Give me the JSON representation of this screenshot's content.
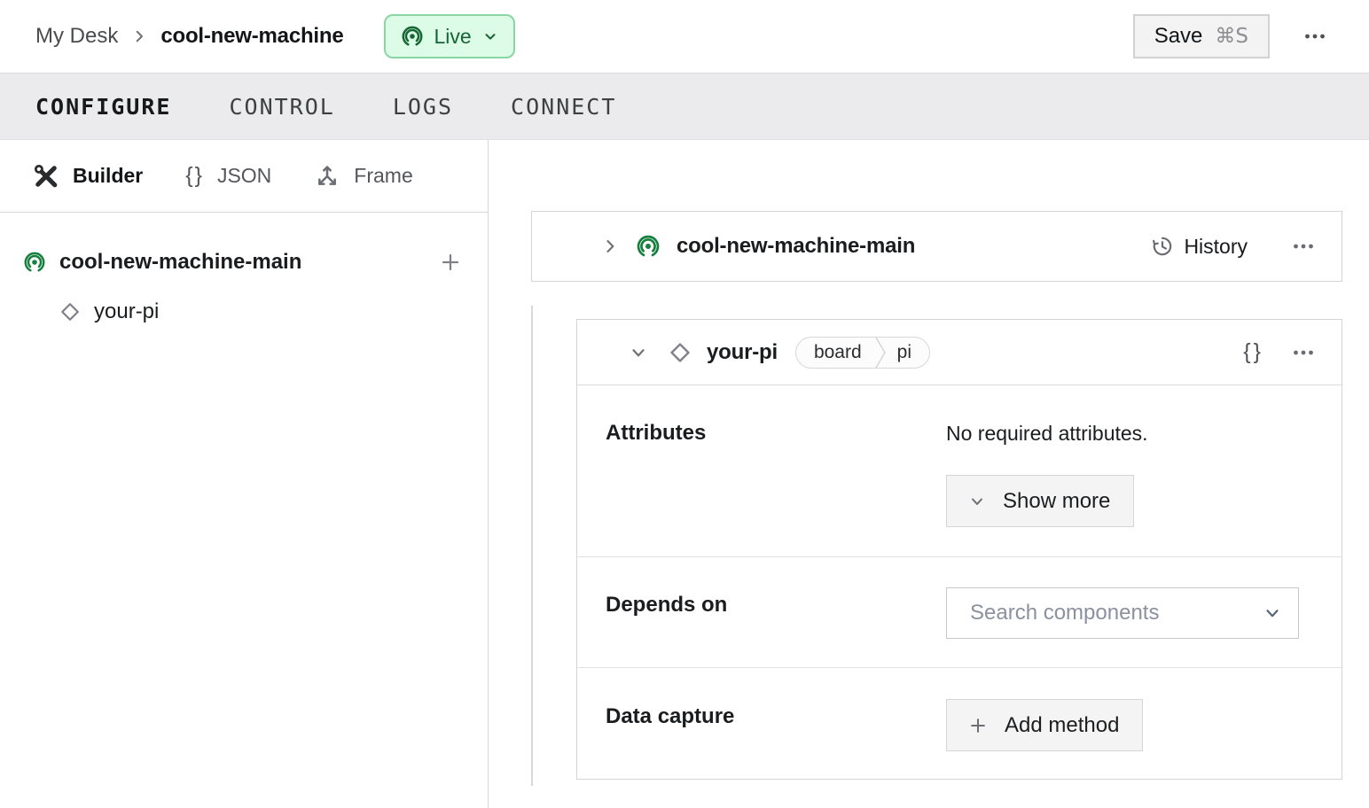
{
  "header": {
    "breadcrumb": {
      "parent": "My Desk",
      "current": "cool-new-machine"
    },
    "live_badge": {
      "label": "Live"
    },
    "save_button": {
      "label": "Save",
      "shortcut": "⌘S"
    }
  },
  "tabs": [
    {
      "label": "CONFIGURE",
      "active": true
    },
    {
      "label": "CONTROL",
      "active": false
    },
    {
      "label": "LOGS",
      "active": false
    },
    {
      "label": "CONNECT",
      "active": false
    }
  ],
  "sidebar": {
    "modes": [
      {
        "label": "Builder",
        "icon": "crossed-tools-icon",
        "active": true
      },
      {
        "label": "JSON",
        "icon": "braces-icon",
        "active": false
      },
      {
        "label": "Frame",
        "icon": "frame-axes-icon",
        "active": false
      }
    ],
    "tree": [
      {
        "label": "cool-new-machine-main",
        "type": "machine-part",
        "icon": "broadcast-icon"
      },
      {
        "label": "your-pi",
        "type": "component",
        "icon": "diamond-icon"
      }
    ]
  },
  "main": {
    "part_card": {
      "title": "cool-new-machine-main",
      "history_label": "History"
    },
    "component_card": {
      "title": "your-pi",
      "type_chip": {
        "type": "board",
        "model": "pi"
      },
      "braces_icon_label": "{}",
      "attributes": {
        "label": "Attributes",
        "empty_text": "No required attributes.",
        "show_more_label": "Show more"
      },
      "depends_on": {
        "label": "Depends on",
        "search_placeholder": "Search components"
      },
      "data_capture": {
        "label": "Data capture",
        "add_method_label": "Add method"
      }
    }
  },
  "icons": {
    "json_braces": "{}"
  },
  "colors": {
    "accent_green": "#15803d",
    "live_badge_bg": "#dcfce7",
    "live_badge_border": "#8ad6a2",
    "live_badge_text": "#166534",
    "tabbar_bg": "#ebebed",
    "card_border": "#d4d4d6",
    "button_bg": "#f4f4f4"
  }
}
